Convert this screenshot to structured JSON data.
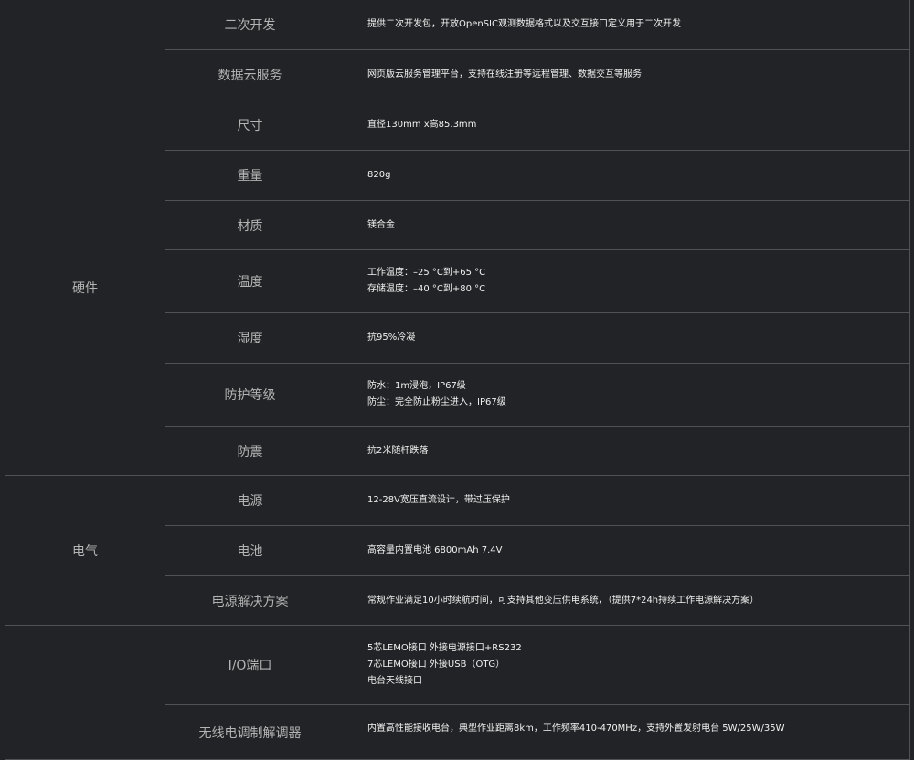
{
  "rows": [
    {
      "param": "二次开发",
      "lines": [
        "提供二次开发包，开放OpenSIC观测数据格式以及交互接口定义用于二次开发"
      ]
    },
    {
      "param": "数据云服务",
      "lines": [
        "网页版云服务管理平台，支持在线注册等远程管理、数据交互等服务"
      ]
    }
  ],
  "groups": [
    {
      "category": "硬件",
      "rows": [
        {
          "param": "尺寸",
          "lines": [
            "直径130mm x高85.3mm"
          ]
        },
        {
          "param": "重量",
          "lines": [
            "820g"
          ]
        },
        {
          "param": "材质",
          "lines": [
            "镁合金"
          ]
        },
        {
          "param": "温度",
          "lines": [
            "工作温度：–25 °C到+65 °C",
            "存储温度：–40 °C到+80 °C"
          ]
        },
        {
          "param": "湿度",
          "lines": [
            "抗95%冷凝"
          ]
        },
        {
          "param": "防护等级",
          "lines": [
            "防水：1m浸泡，IP67级",
            "防尘：完全防止粉尘进入，IP67级"
          ]
        },
        {
          "param": "防震",
          "lines": [
            "抗2米随杆跌落"
          ]
        }
      ]
    },
    {
      "category": "电气",
      "rows": [
        {
          "param": "电源",
          "lines": [
            "12-28V宽压直流设计，带过压保护"
          ]
        },
        {
          "param": "电池",
          "lines": [
            "高容量内置电池 6800mAh 7.4V"
          ]
        },
        {
          "param": "电源解决方案",
          "lines": [
            "常规作业满足10小时续航时间，可支持其他变压供电系统，（提供7*24h持续工作电源解决方案）"
          ]
        }
      ]
    },
    {
      "category": "",
      "rows": [
        {
          "param": "I/O端口",
          "lines": [
            "5芯LEMO接口 外接电源接口+RS232",
            "7芯LEMO接口 外接USB（OTG）",
            "电台天线接口"
          ]
        },
        {
          "param": "无线电调制解调器",
          "lines": [
            "内置高性能接收电台，典型作业距离8km，工作频率410-470MHz，支持外置发射电台 5W/25W/35W"
          ]
        }
      ]
    }
  ]
}
